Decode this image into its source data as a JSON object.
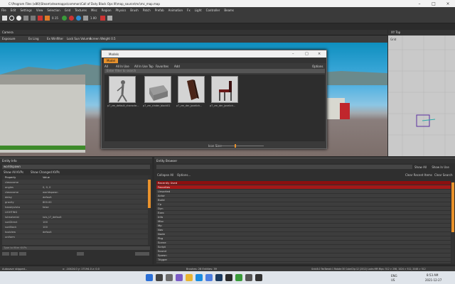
{
  "window": {
    "title": "C:\\Program Files (x86)\\Steam\\steamapps\\common\\Call of Duty Black Ops III\\map_source\\mc\\mc_map.map"
  },
  "menu": [
    "File",
    "Edit",
    "Settings",
    "View",
    "Selection",
    "Grid",
    "Textures",
    "Misc",
    "Region",
    "Physics",
    "Brush",
    "Patch",
    "Prefab",
    "Animation",
    "Fx",
    "Light",
    "Controller",
    "Beams"
  ],
  "toolbar": {
    "field1": "0.15",
    "field2": "1.00"
  },
  "camera": {
    "title": "Camera",
    "options": [
      "Exposure",
      "Ex Ling",
      "Ex Winfilter",
      "Lock Sun Volume",
      "Screen Weight 0.5"
    ]
  },
  "xy": {
    "title": "XY Top",
    "label": "Grid"
  },
  "models": {
    "title": "Models",
    "tab": "Model",
    "filters": [
      "All",
      "All In Use",
      "All In Use Top",
      "Favorites",
      "Add"
    ],
    "options_label": "Options",
    "search_placeholder": "Enter filter to search",
    "items": [
      {
        "label": "p7_zm_default_characte...",
        "icon": "character-model-icon"
      },
      {
        "label": "p7_zm_cinder_block01",
        "icon": "cinder-block-icon"
      },
      {
        "label": "p7_zm_der_jovelich...",
        "icon": "wooden-plank-icon"
      },
      {
        "label": "p7_zm_der_jovelich...",
        "icon": "chair-icon"
      }
    ],
    "icon_size_label": "Icon Size:"
  },
  "entity_info": {
    "title": "Entity Info",
    "name": "worldspawn",
    "show_all": "Show All KVPs",
    "show_changed": "Show Changed KVPs",
    "header": {
      "property": "Property",
      "value": "Value"
    },
    "rows": [
      {
        "k": "classname",
        "v": ""
      },
      {
        "k": "angles",
        "v": "0, 0, 0"
      },
      {
        "k": "classname",
        "v": "worldspawn"
      },
      {
        "k": "delay",
        "v": "default"
      },
      {
        "k": "gravity",
        "v": "800.00"
      },
      {
        "k": "hasskyvista",
        "v": "false"
      },
      {
        "k": "LIGHTING",
        "v": ""
      },
      {
        "k": "lutmaterial",
        "v": "luts_t7_default"
      },
      {
        "k": "sunDirect",
        "v": "100"
      },
      {
        "k": "sunBlock",
        "v": "100"
      },
      {
        "k": "toolview",
        "v": "default"
      },
      {
        "k": "uniform",
        "v": ""
      }
    ],
    "search_placeholder": "Type to filter KVPs"
  },
  "browser": {
    "title": "Entity Browser",
    "show_all": "Show All",
    "show_in_use": "Show In Use",
    "collapse": "Collapse All",
    "options": "Options...",
    "clear_recent": "Clear Recent Items",
    "clear_search": "Clear Search",
    "items": [
      "Recently Used",
      "Favorites",
      "Unsorted",
      "Actor",
      "Build",
      "Cp",
      "Dyn",
      "Exec",
      "Info",
      "Misc",
      "Mp",
      "Nav",
      "Node",
      "Pbg",
      "Scene",
      "Script",
      "Sound",
      "Spawn",
      "Trigger"
    ]
  },
  "status": {
    "left": "Autosave skipped...",
    "coords": "x: -10424.0  y: 17194.0  z: 0.0",
    "brushes": "Brushes: 28  Entities: 39",
    "right": "Grid:8.0  TexTweak:1  Rotate:30  CubeClip:12 (2012)  Locks:MR  Mips: 512 > 256, 1024 > 512, 2048 > 512"
  },
  "taskbar": {
    "lang1": "ENG",
    "lang2": "US",
    "time": "8:53 AM",
    "date": "2021-12-27"
  }
}
